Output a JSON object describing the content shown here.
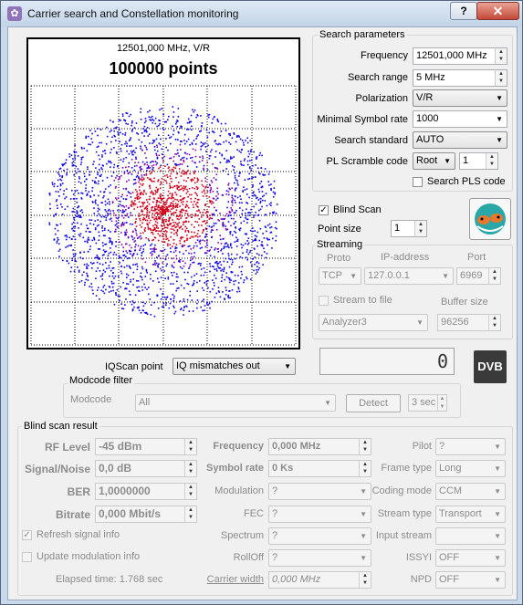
{
  "window": {
    "title": "Carrier search and Constellation monitoring",
    "help_label": "?",
    "close_label": "✕"
  },
  "plot": {
    "freq_label": "12501,000 MHz, V/R",
    "points_label": "100000 points"
  },
  "search": {
    "legend": "Search parameters",
    "frequency_label": "Frequency",
    "frequency_value": "12501,000 MHz",
    "range_label": "Search range",
    "range_value": "5 MHz",
    "polarization_label": "Polarization",
    "polarization_value": "V/R",
    "minsr_label": "Minimal Symbol rate",
    "minsr_value": "1000",
    "standard_label": "Search standard",
    "standard_value": "AUTO",
    "pls_label": "PL Scramble code",
    "pls_mode": "Root",
    "pls_value": "1",
    "search_pls_label": "Search PLS code"
  },
  "blind": {
    "label": "Blind Scan",
    "point_size_label": "Point size",
    "point_size_value": "1"
  },
  "streaming": {
    "legend": "Streaming",
    "proto_header": "Proto",
    "ip_header": "IP-address",
    "port_header": "Port",
    "proto_value": "TCP",
    "ip_value": "127.0.0.1",
    "port_value": "6969",
    "file_label": "Stream to file",
    "buffer_header": "Buffer size",
    "file_value": "Analyzer3",
    "buffer_value": "96256"
  },
  "iq": {
    "label": "IQScan point",
    "value": "IQ mismatches out",
    "counter": "0",
    "logo": "DVB"
  },
  "modcode": {
    "legend": "Modcode filter",
    "label": "Modcode",
    "value": "All",
    "detect_label": "Detect",
    "interval_value": "3 sec"
  },
  "result": {
    "legend": "Blind scan result",
    "rf_label": "RF Level",
    "rf_value": "-45 dBm",
    "sn_label": "Signal/Noise",
    "sn_value": "0,0 dB",
    "ber_label": "BER",
    "ber_value": "1,0000000",
    "bitrate_label": "Bitrate",
    "bitrate_value": "0,000 Mbit/s",
    "freq_label": "Frequency",
    "freq_value": "0,000 MHz",
    "sr_label": "Symbol rate",
    "sr_value": "0 Ks",
    "mod_label": "Modulation",
    "mod_value": "?",
    "fec_label": "FEC",
    "fec_value": "?",
    "spectrum_label": "Spectrum",
    "spectrum_value": "?",
    "rolloff_label": "RollOff",
    "rolloff_value": "?",
    "cw_label": "Carrier width",
    "cw_value": "0,000 MHz",
    "pilot_label": "Pilot",
    "pilot_value": "?",
    "frame_label": "Frame type",
    "frame_value": "Long",
    "coding_label": "Coding mode",
    "coding_value": "CCM",
    "stream_label": "Stream type",
    "stream_value": "Transport",
    "input_label": "Input stream",
    "input_value": "",
    "issyi_label": "ISSYI",
    "issyi_value": "OFF",
    "npd_label": "NPD",
    "npd_value": "OFF",
    "refresh_label": "Refresh signal info",
    "update_label": "Update modulation info",
    "elapsed_label": "Elapsed time: 1.768 sec"
  },
  "colors": {
    "scatter_outer": "#0a00e6",
    "scatter_inner": "#d4001a"
  }
}
